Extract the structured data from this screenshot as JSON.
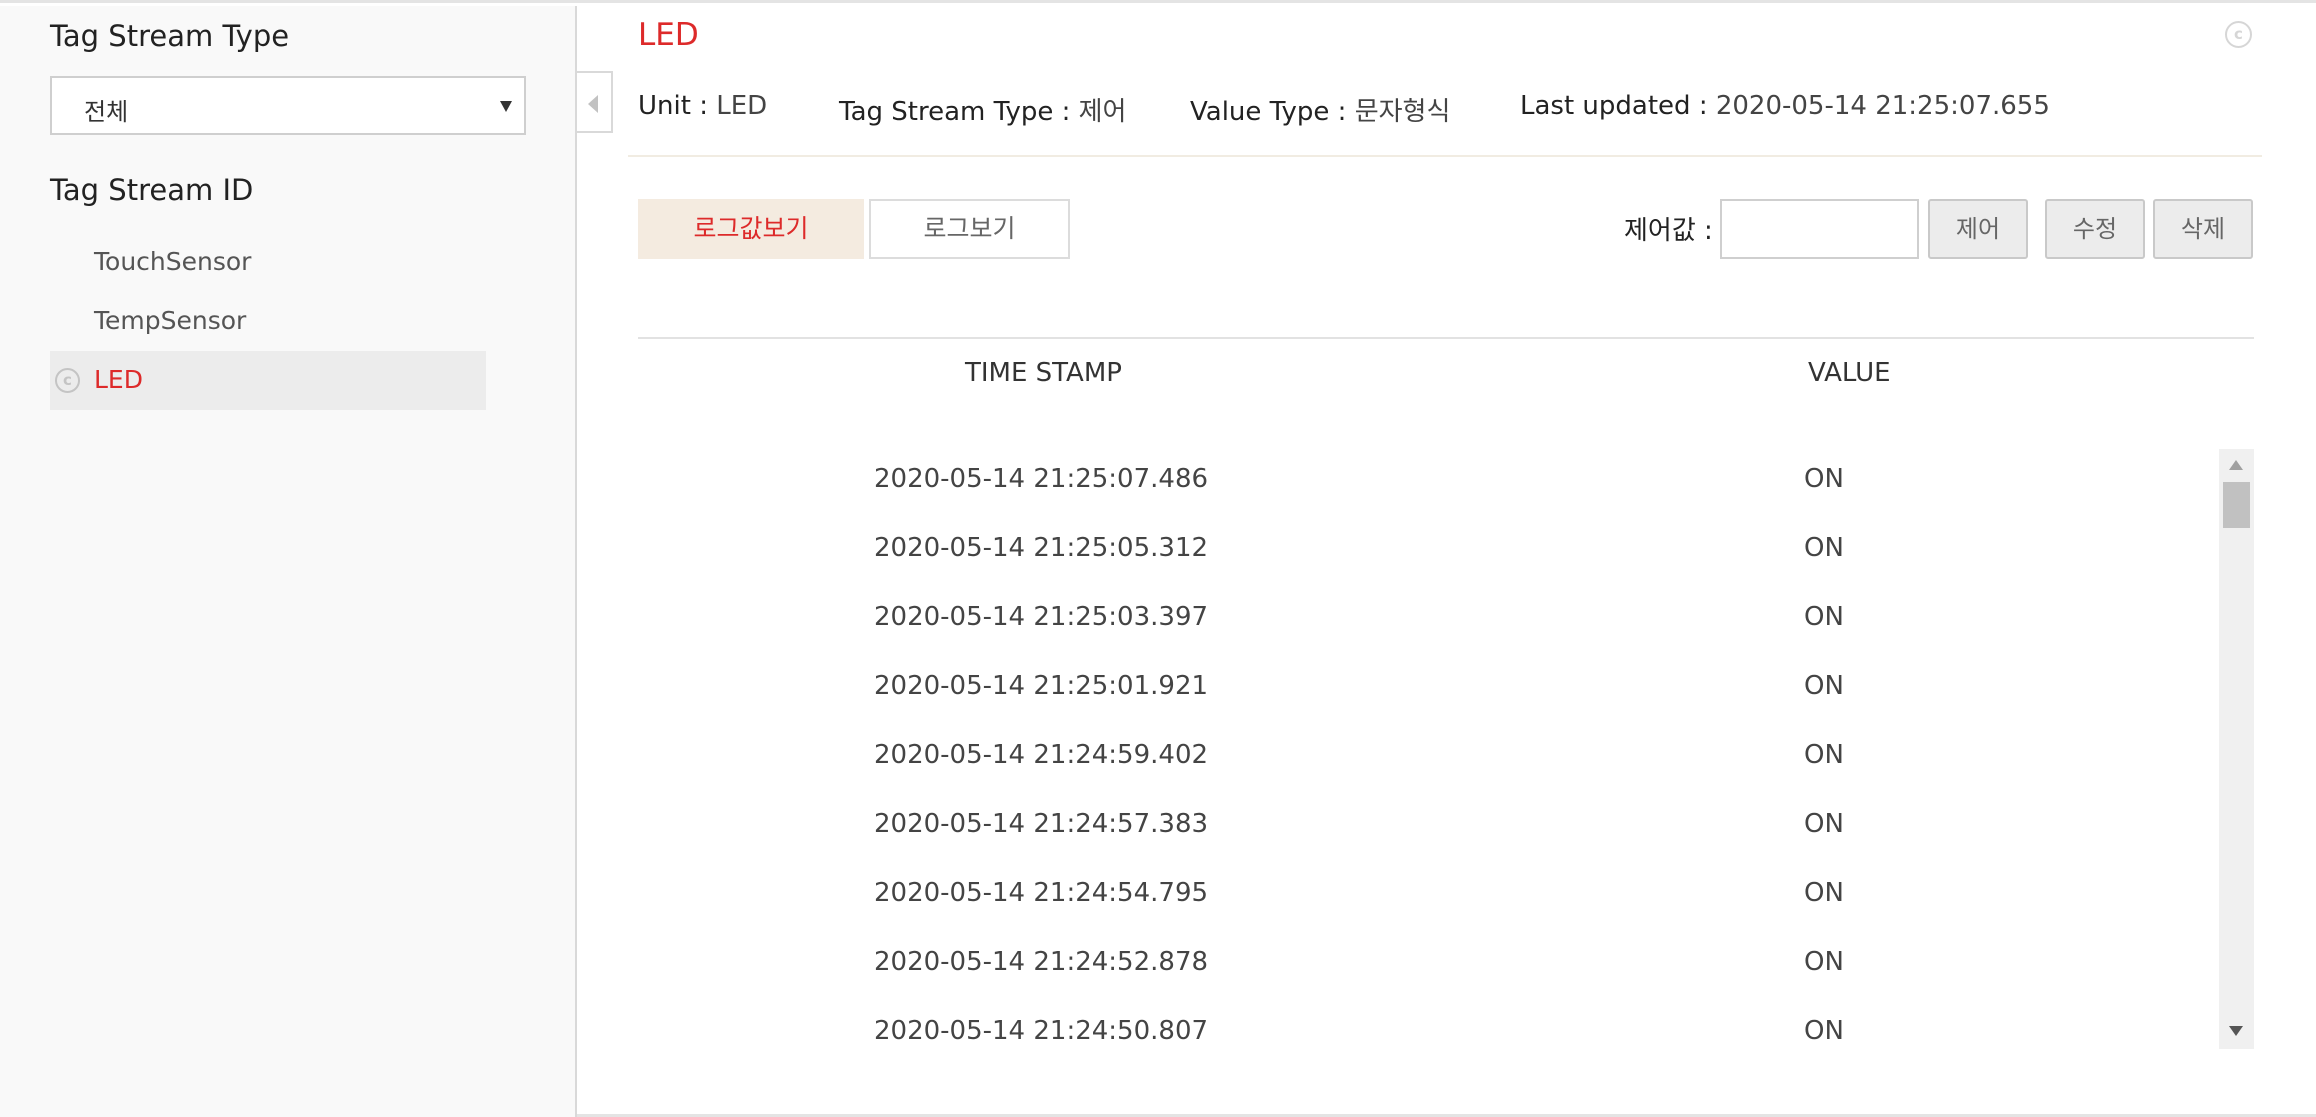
{
  "sidebar": {
    "type_heading": "Tag Stream Type",
    "type_select_value": "전체",
    "id_heading": "Tag Stream ID",
    "items": [
      {
        "label": "TouchSensor",
        "active": false
      },
      {
        "label": "TempSensor",
        "active": false
      },
      {
        "label": "LED",
        "active": true
      }
    ],
    "active_item_icon": "copyright-circle-icon"
  },
  "main": {
    "title": "LED",
    "corner_icon": "copyright-circle-icon",
    "meta": {
      "unit_label": "Unit",
      "unit_value": "LED",
      "stream_type_label": "Tag Stream Type",
      "stream_type_value": "제어",
      "value_type_label": "Value Type",
      "value_type_value": "문자형식",
      "last_updated_label": "Last updated",
      "last_updated_value": "2020-05-14 21:25:07.655",
      "separator": ":"
    },
    "tabs": {
      "log_values": "로그값보기",
      "logs": "로그보기"
    },
    "control": {
      "label": "제어값 :",
      "input_value": "",
      "control_button": "제어",
      "edit_button": "수정",
      "delete_button": "삭제"
    },
    "table": {
      "headers": {
        "time": "TIME STAMP",
        "value": "VALUE"
      },
      "rows": [
        {
          "time": "2020-05-14 21:25:07.486",
          "value": "ON"
        },
        {
          "time": "2020-05-14 21:25:05.312",
          "value": "ON"
        },
        {
          "time": "2020-05-14 21:25:03.397",
          "value": "ON"
        },
        {
          "time": "2020-05-14 21:25:01.921",
          "value": "ON"
        },
        {
          "time": "2020-05-14 21:24:59.402",
          "value": "ON"
        },
        {
          "time": "2020-05-14 21:24:57.383",
          "value": "ON"
        },
        {
          "time": "2020-05-14 21:24:54.795",
          "value": "ON"
        },
        {
          "time": "2020-05-14 21:24:52.878",
          "value": "ON"
        },
        {
          "time": "2020-05-14 21:24:50.807",
          "value": "ON"
        }
      ]
    }
  },
  "colors": {
    "accent": "#dd2a2a",
    "active_tab_bg": "#f4ebe0",
    "sidebar_bg": "#f9f9f9"
  }
}
